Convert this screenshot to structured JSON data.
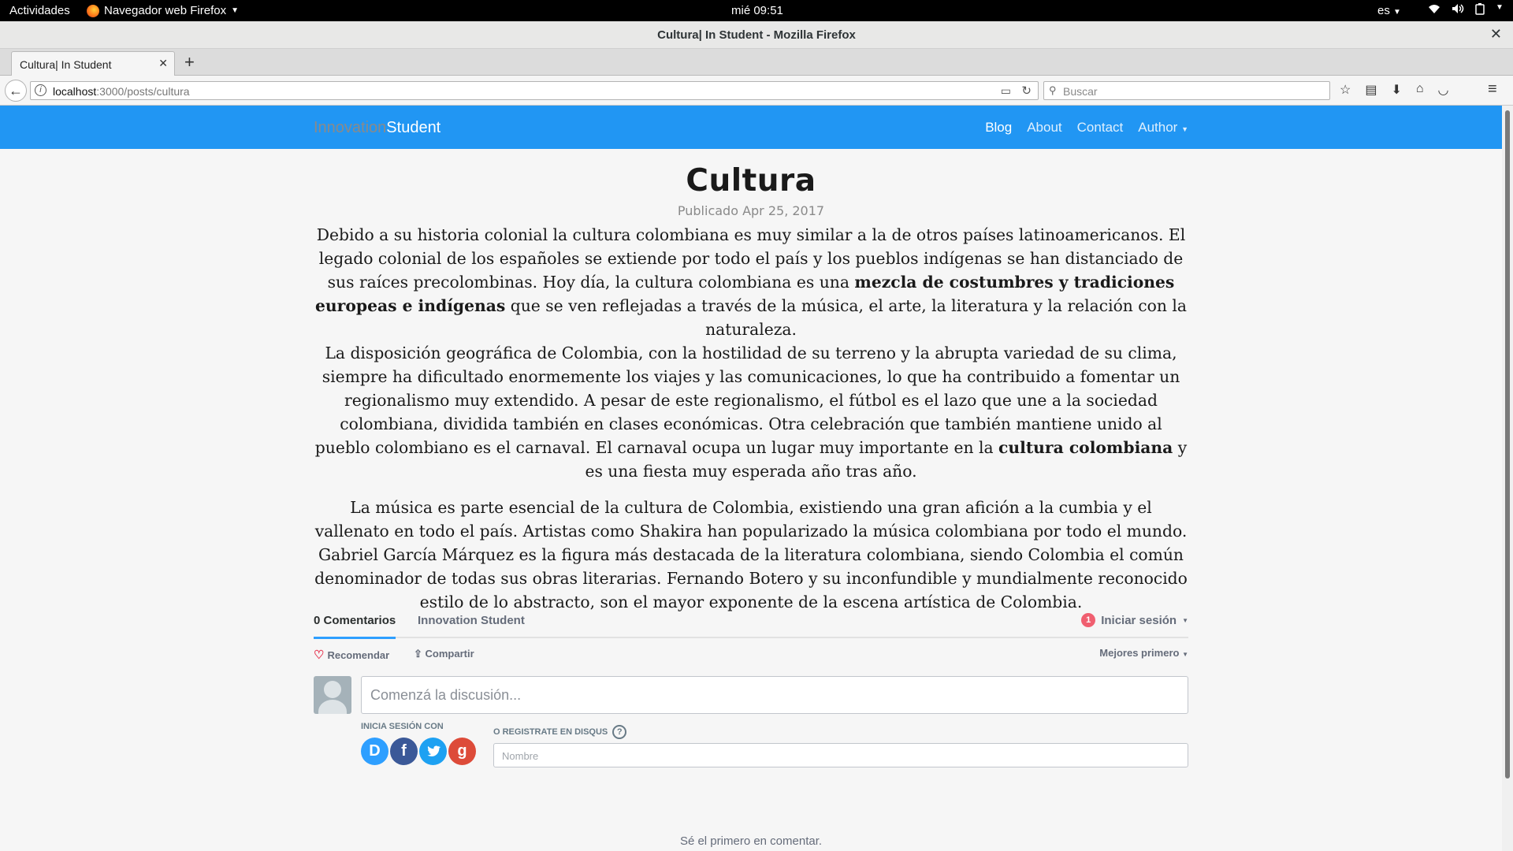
{
  "gnome": {
    "activities": "Actividades",
    "app_menu": "Navegador web Firefox",
    "clock": "mié 09:51",
    "lang": "es"
  },
  "window": {
    "title": "Cultura| In Student - Mozilla Firefox"
  },
  "browser": {
    "tab_label": "Cultura| In Student",
    "url_host": "localhost",
    "url_path": ":3000/posts/cultura",
    "search_placeholder": "Buscar"
  },
  "site": {
    "brand_part1": "Innovation",
    "brand_part2": "Student",
    "nav": [
      "Blog",
      "About",
      "Contact",
      "Author"
    ],
    "accent": "#2196f3"
  },
  "article": {
    "title": "Cultura",
    "date": "Publicado Apr 25, 2017",
    "p1_a": "Debido a su historia colonial la cultura colombiana es muy similar a la de otros países latinoamericanos. El legado colonial de los españoles se extiende por  todo el país y los pueblos indígenas se han distanciado de sus raíces precolombinas. Hoy día, la cultura colombiana es una ",
    "p1_b": "mezcla de costumbres y tradiciones europeas e indígenas",
    "p1_c": " que se ven reflejadas a través de la música, el arte, la literatura y la relación con la naturaleza.",
    "p1_d": "La disposición geográfica de Colombia, con la hostilidad de su terreno y la abrupta variedad de su clima, siempre ha dificultado enormemente los viajes y las comunicaciones, lo que ha contribuido a fomentar un regionalismo muy extendido. A pesar de este regionalismo, el fútbol es el lazo que une a la sociedad colombiana, dividida también en clases económicas. Otra celebración que también mantiene unido al pueblo colombiano es el carnaval. El carnaval ocupa un lugar muy importante en la ",
    "p1_e": "cultura colombiana",
    "p1_f": " y es una fiesta muy esperada año tras año.",
    "p2": "La música es parte esencial de la cultura de Colombia, existiendo una gran afición a la cumbia y el vallenato en todo el país. Artistas como Shakira han popularizado la música colombiana por todo el mundo. Gabriel García Márquez es la figura más destacada de la literatura colombiana, siendo Colombia el común denominador de todas sus obras literarias. Fernando Botero y su inconfundible y mundialmente reconocido estilo de lo abstracto, son el mayor exponente de la escena artística de Colombia."
  },
  "disqus": {
    "count_tab": "0 Comentarios",
    "forum_tab": "Innovation Student",
    "login_badge": "1",
    "login": "Iniciar sesión",
    "recommend": "Recomendar",
    "share": "Compartir",
    "sort": "Mejores primero",
    "compose_placeholder": "Comenzá la discusión...",
    "login_with": "INICIA SESIÓN CON",
    "register": "O REGISTRATE EN DISQUS",
    "name_placeholder": "Nombre",
    "first_comment": "Sé el primero en comentar.",
    "social_icons": [
      {
        "name": "disqus-icon",
        "glyph": "D",
        "color": "#2e9fff"
      },
      {
        "name": "facebook-icon",
        "glyph": "f",
        "color": "#3b5998"
      },
      {
        "name": "twitter-icon",
        "glyph": "t",
        "color": "#1da1f2"
      },
      {
        "name": "google-icon",
        "glyph": "g",
        "color": "#dd4b39"
      }
    ]
  }
}
